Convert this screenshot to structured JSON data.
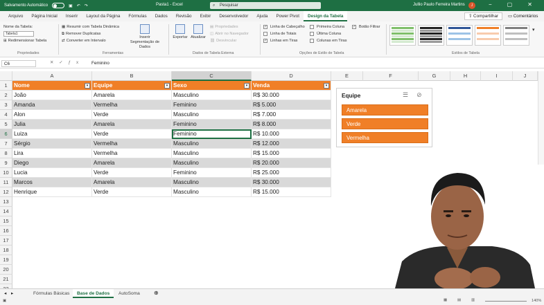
{
  "titlebar": {
    "autosave_label": "Salvamento Automático",
    "document_title": "Pasta1 - Excel",
    "search_placeholder": "Pesquisar",
    "user_name": "Jullio Paulo Ferreira Martins",
    "user_initials": "J"
  },
  "tabs": [
    "Arquivo",
    "Página Inicial",
    "Inserir",
    "Layout da Página",
    "Fórmulas",
    "Dados",
    "Revisão",
    "Exibir",
    "Desenvolvedor",
    "Ajuda",
    "Power Pivot",
    "Design da Tabela"
  ],
  "active_tab": "Design da Tabela",
  "share_label": "Compartilhar",
  "comments_label": "Comentários",
  "ribbon": {
    "table_name_label": "Nome da Tabela:",
    "table_name_value": "Tabela1",
    "resize_label": "Redimensionar Tabela",
    "properties_group": "Propriedades",
    "summarize_pivot": "Resumir com Tabela Dinâmica",
    "remove_duplicates": "Remover Duplicatas",
    "convert_range": "Converter em Intervalo",
    "tools_group": "Ferramentas",
    "insert_slicer": "Inserir Segmentação de Dados",
    "export": "Exportar",
    "refresh": "Atualizar",
    "properties": "Propriedades",
    "open_browser": "Abrir no Navegador",
    "unlink": "Desvincular",
    "external_group": "Dados de Tabela Externa",
    "options": [
      {
        "label": "Linha de Cabeçalho",
        "checked": true
      },
      {
        "label": "Linha de Totais",
        "checked": false
      },
      {
        "label": "Linhas em Tiras",
        "checked": true
      },
      {
        "label": "Primeira Coluna",
        "checked": false
      },
      {
        "label": "Última Coluna",
        "checked": false
      },
      {
        "label": "Colunas em Tiras",
        "checked": false
      },
      {
        "label": "Botão Filtrar",
        "checked": true
      }
    ],
    "options_group": "Opções de Estilo de Tabela",
    "styles_group": "Estilos de Tabela"
  },
  "formula_bar": {
    "name_box": "C6",
    "formula": "Feminino"
  },
  "columns": [
    "A",
    "B",
    "C",
    "D",
    "E",
    "F",
    "G",
    "H",
    "I",
    "J"
  ],
  "rows": [
    "1",
    "2",
    "3",
    "4",
    "5",
    "6",
    "7",
    "8",
    "9",
    "10",
    "11",
    "12",
    "13",
    "14",
    "15",
    "16",
    "17",
    "18",
    "19",
    "20",
    "21",
    "22"
  ],
  "table": {
    "headers": [
      "Nome",
      "Equipe",
      "Sexo",
      "Venda"
    ],
    "rows": [
      [
        "João",
        "Amarela",
        "Masculino",
        "R$ 30.000"
      ],
      [
        "Amanda",
        "Vermelha",
        "Feminino",
        "R$ 5.000"
      ],
      [
        "Alon",
        "Verde",
        "Masculino",
        "R$ 7.000"
      ],
      [
        "Julia",
        "Amarela",
        "Feminino",
        "R$ 8.000"
      ],
      [
        "Luiza",
        "Verde",
        "Feminino",
        "R$ 10.000"
      ],
      [
        "Sérgio",
        "Vermelha",
        "Masculino",
        "R$ 12.000"
      ],
      [
        "Lira",
        "Vermelha",
        "Masculino",
        "R$ 15.000"
      ],
      [
        "Diego",
        "Amarela",
        "Masculino",
        "R$ 20.000"
      ],
      [
        "Lucia",
        "Verde",
        "Feminino",
        "R$ 25.000"
      ],
      [
        "Marcos",
        "Amarela",
        "Masculino",
        "R$ 30.000"
      ],
      [
        "Henrique",
        "Verde",
        "Masculino",
        "R$ 15.000"
      ]
    ]
  },
  "slicer": {
    "title": "Equipe",
    "items": [
      "Amarela",
      "Verde",
      "Vermelha"
    ]
  },
  "sheets": [
    "Fórmulas Básicas",
    "Base de Dados",
    "AutoSoma"
  ],
  "active_sheet": "Base de Dados",
  "status": {
    "zoom": "140%"
  },
  "colors": {
    "excel_green": "#1e6f43",
    "table_orange": "#f07f27",
    "band_gray": "#d9d9d9"
  }
}
